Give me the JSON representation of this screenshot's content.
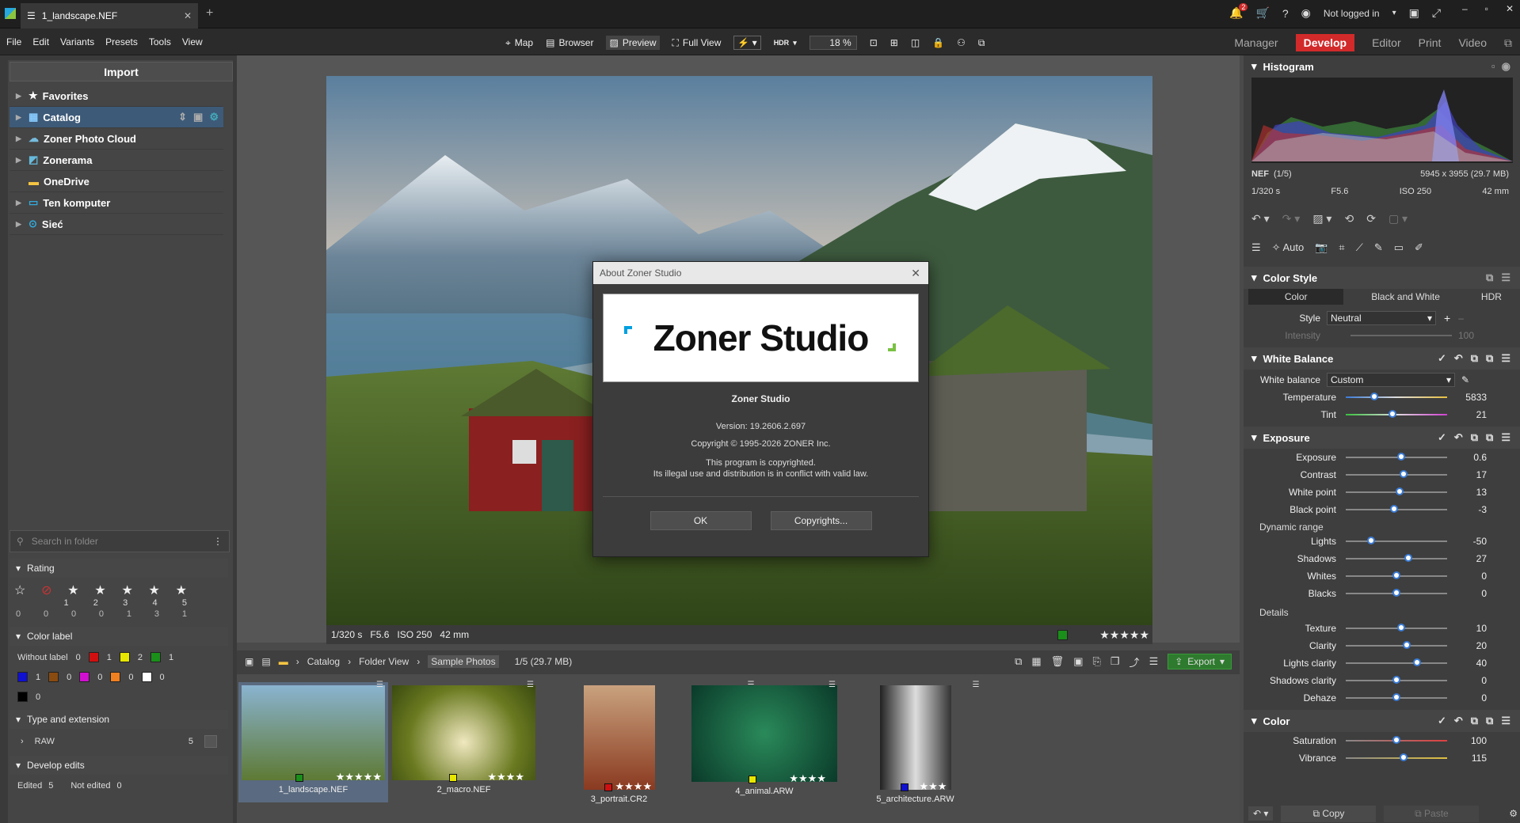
{
  "tab": {
    "title": "1_landscape.NEF"
  },
  "topright": {
    "login": "Not logged in",
    "notif_count": "2"
  },
  "menu": [
    "File",
    "Edit",
    "Variants",
    "Presets",
    "Tools",
    "View"
  ],
  "toolbar": {
    "map": "Map",
    "browser": "Browser",
    "preview": "Preview",
    "fullview": "Full View",
    "hdr": "HDR",
    "zoom": "18 %"
  },
  "modes": [
    "Manager",
    "Develop",
    "Editor",
    "Print",
    "Video"
  ],
  "left": {
    "import": "Import",
    "tree": [
      "Favorites",
      "Catalog",
      "Zoner Photo Cloud",
      "Zonerama",
      "OneDrive",
      "Ten komputer",
      "Sieć"
    ],
    "search_placeholder": "Search in folder",
    "rating_title": "Rating",
    "rating_nums": [
      "",
      "",
      "1",
      "2",
      "3",
      "4",
      "5"
    ],
    "rating_counts": [
      "0",
      "0",
      "0",
      "0",
      "1",
      "3",
      "1"
    ],
    "colorlabel_title": "Color label",
    "without_label": "Without label",
    "color_counts": {
      "without": "0",
      "red": "1",
      "yellow": "2",
      "green": "1",
      "blue": "1",
      "brown": "0",
      "magenta": "0",
      "orange": "0",
      "white": "0",
      "black": "0"
    },
    "type_title": "Type and extension",
    "raw": "RAW",
    "raw_count": "5",
    "develop_title": "Develop edits",
    "edited": "Edited",
    "edited_count": "5",
    "not_edited": "Not edited",
    "not_edited_count": "0"
  },
  "photo_info": {
    "shutter": "1/320 s",
    "aperture": "F5.6",
    "iso": "ISO 250",
    "focal": "42 mm"
  },
  "breadcrumb": [
    "Catalog",
    "Folder View",
    "Sample Photos"
  ],
  "breadcrumb_info": "1/5 (29.7 MB)",
  "export": "Export",
  "thumbs": [
    {
      "name": "1_landscape.NEF",
      "color": "#1a8f1a",
      "stars": "★★★★★"
    },
    {
      "name": "2_macro.NEF",
      "color": "#e6e600",
      "stars": "★★★★"
    },
    {
      "name": "3_portrait.CR2",
      "color": "#d01010",
      "stars": "★★★★"
    },
    {
      "name": "4_animal.ARW",
      "color": "#e6e600",
      "stars": "★★★★"
    },
    {
      "name": "5_architecture.ARW",
      "color": "#1010d0",
      "stars": "★★★"
    }
  ],
  "dialog": {
    "title": "About Zoner Studio",
    "logo": "Zoner Studio",
    "name": "Zoner Studio",
    "version": "Version: 19.2606.2.697",
    "copyright": "Copyright © 1995-2026 ZONER Inc.",
    "line1": "This program is copyrighted.",
    "line2": "Its illegal use and distribution is in conflict with valid law.",
    "ok": "OK",
    "copyrights": "Copyrights..."
  },
  "right": {
    "histogram": "Histogram",
    "format": "NEF",
    "index": "(1/5)",
    "dims": "5945 x 3955 (29.7 MB)",
    "shutter": "1/320 s",
    "aperture": "F5.6",
    "iso": "ISO 250",
    "focal": "42 mm",
    "auto": "Auto",
    "colorstyle": "Color Style",
    "cs_tabs": [
      "Color",
      "Black and White",
      "HDR"
    ],
    "style_label": "Style",
    "style_value": "Neutral",
    "intensity": "Intensity",
    "intensity_val": "100",
    "wb_title": "White Balance",
    "wb_label": "White balance",
    "wb_value": "Custom",
    "temperature": "Temperature",
    "temperature_val": "5833",
    "tint": "Tint",
    "tint_val": "21",
    "exposure_title": "Exposure",
    "exposure": [
      {
        "label": "Exposure",
        "val": "0.6",
        "pos": 0.55
      },
      {
        "label": "Contrast",
        "val": "17",
        "pos": 0.57
      },
      {
        "label": "White point",
        "val": "13",
        "pos": 0.53
      },
      {
        "label": "Black point",
        "val": "-3",
        "pos": 0.48
      }
    ],
    "dynamic_range": "Dynamic range",
    "dynamic": [
      {
        "label": "Lights",
        "val": "-50",
        "pos": 0.25
      },
      {
        "label": "Shadows",
        "val": "27",
        "pos": 0.62
      },
      {
        "label": "Whites",
        "val": "0",
        "pos": 0.5
      },
      {
        "label": "Blacks",
        "val": "0",
        "pos": 0.5
      }
    ],
    "details": "Details",
    "details_rows": [
      {
        "label": "Texture",
        "val": "10",
        "pos": 0.55
      },
      {
        "label": "Clarity",
        "val": "20",
        "pos": 0.6
      },
      {
        "label": "Lights clarity",
        "val": "40",
        "pos": 0.7
      },
      {
        "label": "Shadows clarity",
        "val": "0",
        "pos": 0.5
      },
      {
        "label": "Dehaze",
        "val": "0",
        "pos": 0.5
      }
    ],
    "color_title": "Color",
    "color_rows": [
      {
        "label": "Saturation",
        "val": "100",
        "pos": 0.5
      },
      {
        "label": "Vibrance",
        "val": "115",
        "pos": 0.57
      }
    ],
    "copy": "Copy",
    "paste": "Paste"
  }
}
